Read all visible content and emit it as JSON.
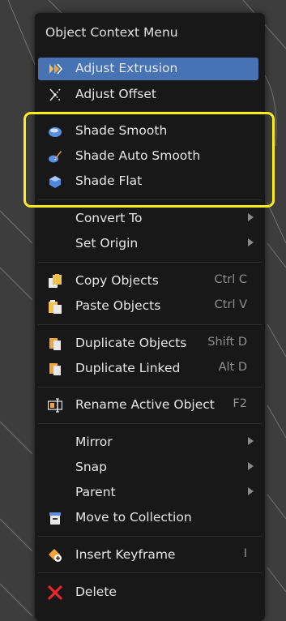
{
  "menu": {
    "title": "Object Context Menu",
    "items": [
      {
        "label": "Adjust Extrusion",
        "icon": "adjust-extrusion-icon",
        "shortcut": "",
        "submenu": false,
        "active": true
      },
      {
        "label": "Adjust Offset",
        "icon": "adjust-offset-icon",
        "shortcut": "",
        "submenu": false,
        "active": false
      },
      {
        "label": "Shade Smooth",
        "icon": "shade-smooth-icon",
        "shortcut": "",
        "submenu": false,
        "active": false
      },
      {
        "label": "Shade Auto Smooth",
        "icon": "shade-auto-smooth-icon",
        "shortcut": "",
        "submenu": false,
        "active": false
      },
      {
        "label": "Shade Flat",
        "icon": "shade-flat-icon",
        "shortcut": "",
        "submenu": false,
        "active": false
      },
      {
        "label": "Convert To",
        "icon": "",
        "shortcut": "",
        "submenu": true,
        "active": false
      },
      {
        "label": "Set Origin",
        "icon": "",
        "shortcut": "",
        "submenu": true,
        "active": false
      },
      {
        "label": "Copy Objects",
        "icon": "copy-icon",
        "shortcut": "Ctrl C",
        "submenu": false,
        "active": false
      },
      {
        "label": "Paste Objects",
        "icon": "paste-icon",
        "shortcut": "Ctrl V",
        "submenu": false,
        "active": false
      },
      {
        "label": "Duplicate Objects",
        "icon": "duplicate-icon",
        "shortcut": "Shift D",
        "submenu": false,
        "active": false
      },
      {
        "label": "Duplicate Linked",
        "icon": "duplicate-linked-icon",
        "shortcut": "Alt D",
        "submenu": false,
        "active": false
      },
      {
        "label": "Rename Active Object",
        "icon": "rename-icon",
        "shortcut": "F2",
        "submenu": false,
        "active": false
      },
      {
        "label": "Mirror",
        "icon": "",
        "shortcut": "",
        "submenu": true,
        "active": false
      },
      {
        "label": "Snap",
        "icon": "",
        "shortcut": "",
        "submenu": true,
        "active": false
      },
      {
        "label": "Parent",
        "icon": "",
        "shortcut": "",
        "submenu": true,
        "active": false
      },
      {
        "label": "Move to Collection",
        "icon": "collection-icon",
        "shortcut": "",
        "submenu": false,
        "active": false
      },
      {
        "label": "Insert Keyframe",
        "icon": "keyframe-icon",
        "shortcut": "I",
        "submenu": false,
        "active": false
      },
      {
        "label": "Delete",
        "icon": "delete-icon",
        "shortcut": "",
        "submenu": false,
        "active": false
      }
    ]
  },
  "colors": {
    "menu_bg": "#181818",
    "active_bg": "#4772b3",
    "highlight_border": "#ffec1a",
    "delete_icon": "#e8262b"
  }
}
